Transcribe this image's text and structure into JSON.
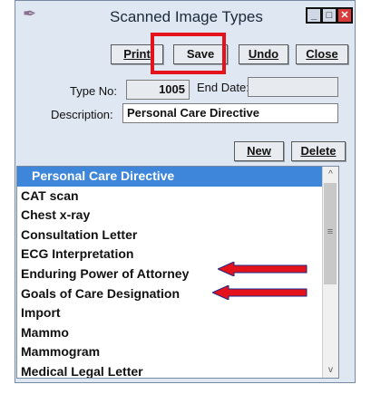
{
  "window": {
    "title": "Scanned Image Types",
    "icon": "quill-icon",
    "controls": {
      "min": "_",
      "max": "□",
      "close": "✕"
    }
  },
  "toolbar": {
    "print": "Print",
    "save": "Save",
    "undo": "Undo",
    "close": "Close"
  },
  "form": {
    "type_no_label": "Type No:",
    "type_no_value": "1005",
    "end_date_label": "End Date:",
    "end_date_value": "",
    "description_label": "Description:",
    "description_value": "Personal Care Directive"
  },
  "actions": {
    "new": "New",
    "delete": "Delete"
  },
  "list": {
    "items": [
      "Personal Care Directive",
      "CAT scan",
      "Chest x-ray",
      "Consultation Letter",
      "ECG Interpretation",
      "Enduring Power of Attorney",
      "Goals of Care Designation",
      "Import",
      "Mammo",
      "Mammogram",
      "Medical Legal Letter"
    ],
    "selected_index": 0,
    "scroll_up": "^",
    "scroll_down": "v",
    "scroll_grip": "≡"
  },
  "colors": {
    "highlight": "#e3121b",
    "selection": "#3d86d9",
    "arrow": "#e3121b"
  }
}
